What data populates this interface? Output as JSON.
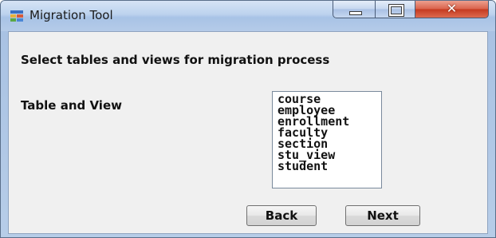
{
  "window": {
    "title": "Migration Tool",
    "caption_buttons": {
      "minimize_icon": "minimize-icon",
      "maximize_icon": "maximize-icon",
      "close_glyph": "✕"
    }
  },
  "main": {
    "heading": "Select tables and views for migration process",
    "table_label": "Table and View",
    "list_items": [
      "course",
      "employee",
      "enrollment",
      "faculty",
      "section",
      "stu_view",
      "student"
    ]
  },
  "buttons": {
    "back_label": "Back",
    "next_label": "Next"
  },
  "colors": {
    "close_button": "#d9614a",
    "frame": "#b3c9e6",
    "client": "#f0f0f0"
  }
}
